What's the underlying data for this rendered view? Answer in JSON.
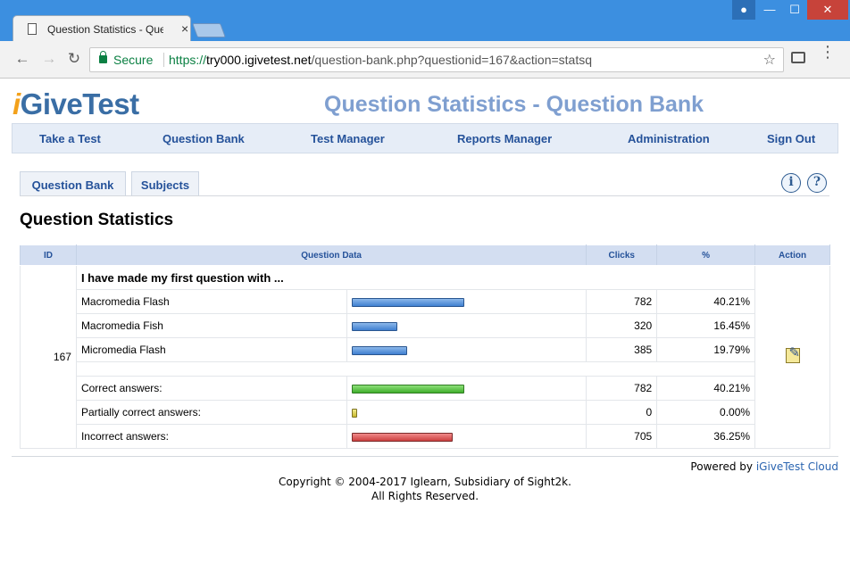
{
  "browser": {
    "tab_title": "Question Statistics - Que",
    "tab_close": "×",
    "secure_label": "Secure",
    "url_proto": "https://",
    "url_host": "try000.igivetest.net",
    "url_path": "/question-bank.php?questionid=167&action=statsq",
    "window_controls": {
      "minimize": "—",
      "maximize": "☐",
      "close": "✕"
    }
  },
  "brand": {
    "logo_i": "i",
    "logo_rest": "GiveTest"
  },
  "page_heading": "Question Statistics - Question Bank",
  "main_nav": [
    "Take a Test",
    "Question Bank",
    "Test Manager",
    "Reports Manager",
    "Administration",
    "Sign Out"
  ],
  "sub_tabs": [
    "Question Bank",
    "Subjects"
  ],
  "help_icons": {
    "info": "i",
    "help": "?"
  },
  "section_title": "Question Statistics",
  "table": {
    "headers": {
      "id": "ID",
      "question_data": "Question Data",
      "clicks": "Clicks",
      "percent": "%",
      "action": "Action"
    },
    "question_id": "167",
    "question_text": "I have made my first question with ...",
    "answers": [
      {
        "label": "Macromedia Flash",
        "clicks": "782",
        "percent": "40.21%",
        "fraction": 0.4021,
        "color": "#3f7fd0"
      },
      {
        "label": "Macromedia Fish",
        "clicks": "320",
        "percent": "16.45%",
        "fraction": 0.1645,
        "color": "#3f7fd0"
      },
      {
        "label": "Micromedia Flash",
        "clicks": "385",
        "percent": "19.79%",
        "fraction": 0.1979,
        "color": "#3f7fd0"
      }
    ],
    "summary": [
      {
        "label": "Correct answers:",
        "clicks": "782",
        "percent": "40.21%",
        "fraction": 0.4021,
        "color": "#3fae2b"
      },
      {
        "label": "Partially correct answers:",
        "clicks": "0",
        "percent": "0.00%",
        "fraction": 0.0,
        "color": "#c9b92e"
      },
      {
        "label": "Incorrect answers:",
        "clicks": "705",
        "percent": "36.25%",
        "fraction": 0.3625,
        "color": "#cc4040"
      }
    ]
  },
  "footer": {
    "powered_by": "Powered by",
    "powered_link": "iGiveTest Cloud",
    "copyright_line1": "Copyright © 2004-2017 Iglearn, Subsidiary of Sight2k.",
    "copyright_line2": "All Rights Reserved."
  }
}
